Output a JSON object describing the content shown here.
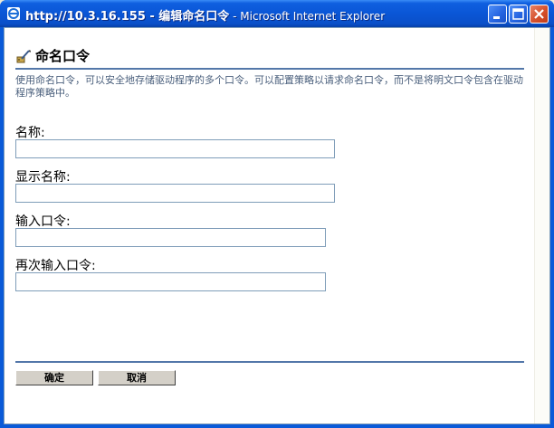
{
  "window": {
    "title_main": "http://10.3.16.155 - 编辑命名口令",
    "title_suffix": " - Microsoft Internet Explorer"
  },
  "page": {
    "heading": "命名口令",
    "description": "使用命名口令，可以安全地存储驱动程序的多个口令。可以配置策略以请求命名口令，而不是将明文口令包含在驱动程序策略中。"
  },
  "form": {
    "name": {
      "label": "名称:",
      "value": ""
    },
    "display_name": {
      "label": "显示名称:",
      "value": ""
    },
    "password": {
      "label": "输入口令:",
      "value": ""
    },
    "confirm_password": {
      "label": "再次输入口令:",
      "value": ""
    }
  },
  "buttons": {
    "ok": "确定",
    "cancel": "取消"
  },
  "colors": {
    "titlebar": "#0a56d6",
    "accent_rule": "#5377a9",
    "description_text": "#4a5f7c",
    "input_border": "#7f9db9",
    "button_face": "#d4d0c8"
  },
  "icons": {
    "window": "ie-icon",
    "heading": "password-pen-icon",
    "minimize": "minimize-icon",
    "maximize": "maximize-icon",
    "close": "close-icon"
  }
}
